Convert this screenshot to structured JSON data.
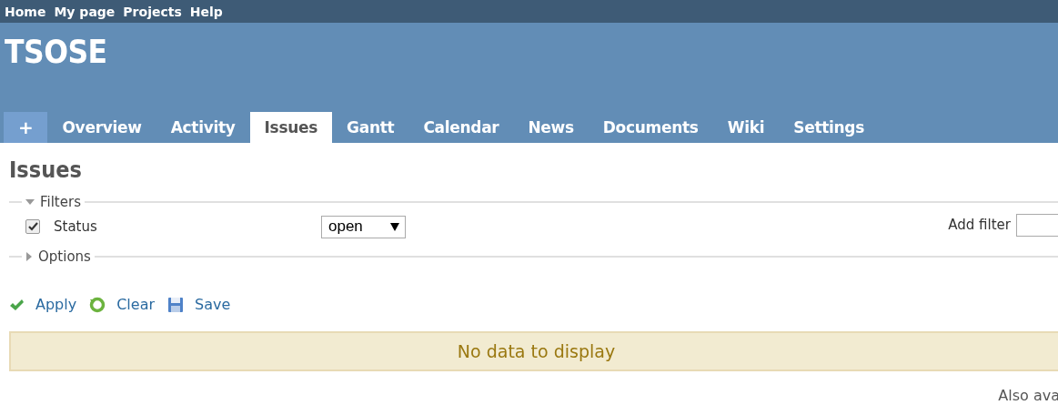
{
  "top_menu": [
    {
      "label": "Home"
    },
    {
      "label": "My page"
    },
    {
      "label": "Projects"
    },
    {
      "label": "Help"
    }
  ],
  "project_title": "TSOSE",
  "tabs": [
    {
      "label": "+",
      "kind": "new",
      "selected": false
    },
    {
      "label": "Overview",
      "kind": "tab",
      "selected": false
    },
    {
      "label": "Activity",
      "kind": "tab",
      "selected": false
    },
    {
      "label": "Issues",
      "kind": "tab",
      "selected": true
    },
    {
      "label": "Gantt",
      "kind": "tab",
      "selected": false
    },
    {
      "label": "Calendar",
      "kind": "tab",
      "selected": false
    },
    {
      "label": "News",
      "kind": "tab",
      "selected": false
    },
    {
      "label": "Documents",
      "kind": "tab",
      "selected": false
    },
    {
      "label": "Wiki",
      "kind": "tab",
      "selected": false
    },
    {
      "label": "Settings",
      "kind": "tab",
      "selected": false
    }
  ],
  "page_title": "Issues",
  "filters": {
    "legend": "Filters",
    "expanded": true,
    "rows": [
      {
        "label": "Status",
        "checked": true,
        "operator": "open"
      }
    ],
    "add_filter_label": "Add filter"
  },
  "options": {
    "legend": "Options",
    "expanded": false
  },
  "actions": [
    {
      "label": "Apply",
      "kind": "apply"
    },
    {
      "label": "Clear",
      "kind": "clear"
    },
    {
      "label": "Save",
      "kind": "save"
    }
  ],
  "empty_message": "No data to display",
  "footer_text": "Also ava"
}
